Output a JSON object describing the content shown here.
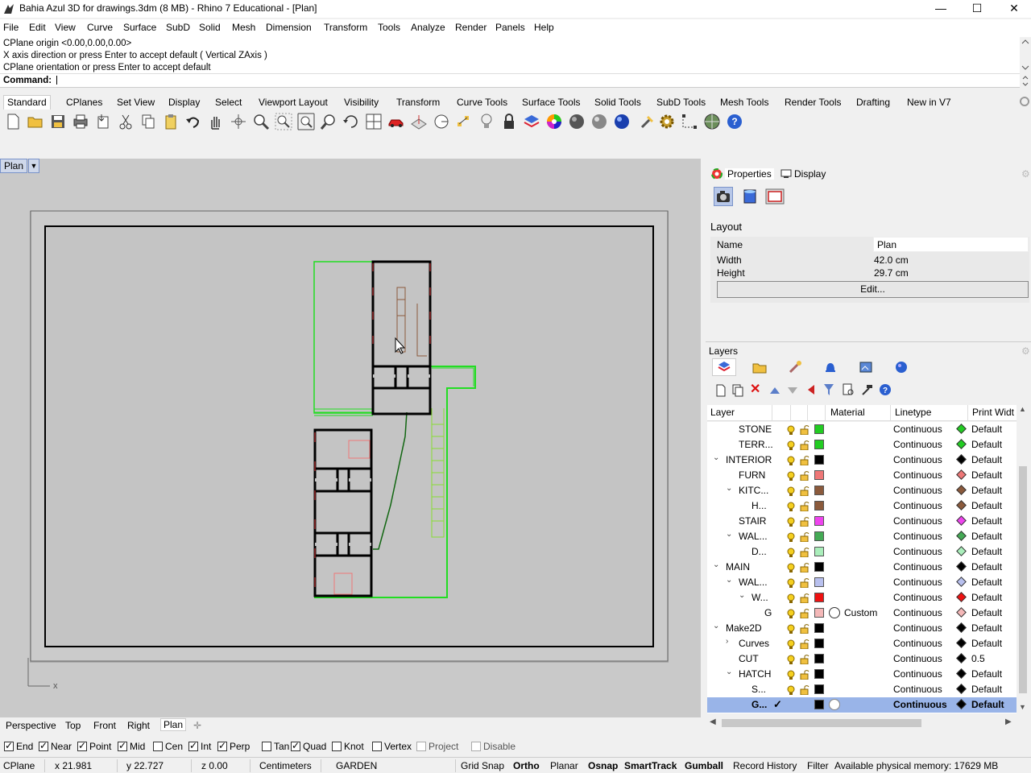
{
  "window": {
    "title": "Bahia Azul 3D for drawings.3dm (8 MB) - Rhino 7 Educational - [Plan]",
    "minimize": "—",
    "maximize": "☐",
    "close": "✕"
  },
  "menu": [
    "File",
    "Edit",
    "View",
    "Curve",
    "Surface",
    "SubD",
    "Solid",
    "Mesh",
    "Dimension",
    "Transform",
    "Tools",
    "Analyze",
    "Render",
    "Panels",
    "Help"
  ],
  "command": {
    "history": [
      "CPlane origin <0.00,0.00,0.00>",
      "X axis direction or press Enter to accept default ( Vertical  ZAxis )",
      "CPlane orientation or press Enter to accept default"
    ],
    "prompt": "Command:"
  },
  "toolbar_tabs": [
    "Standard",
    "CPlanes",
    "Set View",
    "Display",
    "Select",
    "Viewport Layout",
    "Visibility",
    "Transform",
    "Curve Tools",
    "Surface Tools",
    "Solid Tools",
    "SubD Tools",
    "Mesh Tools",
    "Render Tools",
    "Drafting",
    "New in V7"
  ],
  "toolbar_icons": [
    "new-icon",
    "open-icon",
    "save-icon",
    "print-icon",
    "import-icon",
    "cut-icon",
    "copy-icon",
    "paste-icon",
    "undo-icon",
    "pan-icon",
    "rotate-view-icon",
    "zoom-icon",
    "zoom-window-icon",
    "zoom-extents-icon",
    "zoom-selected-icon",
    "rotate-icon",
    "four-viewports-icon",
    "car-icon",
    "cplane-icon",
    "circle-icon",
    "points-icon",
    "light-icon",
    "lock-icon",
    "layers-icon",
    "color-wheel-icon",
    "sphere-gray-icon",
    "sphere-shaded-icon",
    "sphere-blue-icon",
    "brush-icon",
    "gear-icon",
    "dimension-icon",
    "globe-icon",
    "help-icon"
  ],
  "viewport": {
    "label": "Plan",
    "axis_label": "x"
  },
  "view_tabs": [
    "Perspective",
    "Top",
    "Front",
    "Right",
    "Plan"
  ],
  "properties_panel": {
    "tabs": [
      "Properties",
      "Display"
    ],
    "section": "Layout",
    "name_label": "Name",
    "name_value": "Plan",
    "width_label": "Width",
    "width_value": "42.0 cm",
    "height_label": "Height",
    "height_value": "29.7 cm",
    "edit_button": "Edit..."
  },
  "layers_panel": {
    "title": "Layers",
    "columns": [
      "Layer",
      "Material",
      "Linetype",
      "Print Widt"
    ],
    "rows": [
      {
        "name": "STONE",
        "indent": 39,
        "expander": "",
        "color": "#22cc22",
        "linetype": "Continuous",
        "diamond": "#22cc22",
        "pw": "Default",
        "material": ""
      },
      {
        "name": "TERR...",
        "indent": 39,
        "expander": "",
        "color": "#22cc22",
        "linetype": "Continuous",
        "diamond": "#22cc22",
        "pw": "Default",
        "material": ""
      },
      {
        "name": "INTERIOR",
        "indent": 23,
        "expander": "⌄",
        "color": "#000000",
        "linetype": "Continuous",
        "diamond": "#000000",
        "pw": "Default",
        "material": ""
      },
      {
        "name": "FURN",
        "indent": 39,
        "expander": "",
        "color": "#ee7777",
        "linetype": "Continuous",
        "diamond": "#ee7777",
        "pw": "Default",
        "material": ""
      },
      {
        "name": "KITC...",
        "indent": 39,
        "expander": "⌄",
        "color": "#8b5a3c",
        "linetype": "Continuous",
        "diamond": "#8b5a3c",
        "pw": "Default",
        "material": ""
      },
      {
        "name": "H...",
        "indent": 55,
        "expander": "",
        "color": "#8b5a3c",
        "linetype": "Continuous",
        "diamond": "#8b5a3c",
        "pw": "Default",
        "material": ""
      },
      {
        "name": "STAIR",
        "indent": 39,
        "expander": "",
        "color": "#ee44ee",
        "linetype": "Continuous",
        "diamond": "#ee44ee",
        "pw": "Default",
        "material": ""
      },
      {
        "name": "WAL...",
        "indent": 39,
        "expander": "⌄",
        "color": "#44aa55",
        "linetype": "Continuous",
        "diamond": "#44aa55",
        "pw": "Default",
        "material": ""
      },
      {
        "name": "D...",
        "indent": 55,
        "expander": "",
        "color": "#aaeebb",
        "linetype": "Continuous",
        "diamond": "#aaeebb",
        "pw": "Default",
        "material": ""
      },
      {
        "name": "MAIN",
        "indent": 23,
        "expander": "⌄",
        "color": "#000000",
        "linetype": "Continuous",
        "diamond": "#000000",
        "pw": "Default",
        "material": ""
      },
      {
        "name": "WAL...",
        "indent": 39,
        "expander": "⌄",
        "color": "#b8c0ee",
        "linetype": "Continuous",
        "diamond": "#b8c0ee",
        "pw": "Default",
        "material": ""
      },
      {
        "name": "W...",
        "indent": 55,
        "expander": "⌄",
        "color": "#ee1111",
        "linetype": "Continuous",
        "diamond": "#ee1111",
        "pw": "Default",
        "material": ""
      },
      {
        "name": "G",
        "indent": 71,
        "expander": "",
        "color": "#f4b8b8",
        "linetype": "Continuous",
        "diamond": "#f4b8b8",
        "pw": "Default",
        "material": "Custom"
      },
      {
        "name": "Make2D",
        "indent": 23,
        "expander": "⌄",
        "color": "#000000",
        "linetype": "Continuous",
        "diamond": "#000000",
        "pw": "Default",
        "material": ""
      },
      {
        "name": "Curves",
        "indent": 39,
        "expander": "›",
        "color": "#000000",
        "linetype": "Continuous",
        "diamond": "#000000",
        "pw": "Default",
        "material": ""
      },
      {
        "name": "CUT",
        "indent": 39,
        "expander": "",
        "color": "#000000",
        "linetype": "Continuous",
        "diamond": "#000000",
        "pw": "0.5",
        "material": ""
      },
      {
        "name": "HATCH",
        "indent": 39,
        "expander": "⌄",
        "color": "#000000",
        "linetype": "Continuous",
        "diamond": "#000000",
        "pw": "Default",
        "material": ""
      },
      {
        "name": "S...",
        "indent": 55,
        "expander": "",
        "color": "#000000",
        "linetype": "Continuous",
        "diamond": "#000000",
        "pw": "Default",
        "material": ""
      },
      {
        "name": "G...",
        "indent": 55,
        "expander": "",
        "color": "#000000",
        "linetype": "Continuous",
        "diamond": "#000000",
        "pw": "Default",
        "material": "",
        "selected": true
      }
    ]
  },
  "osnap": [
    {
      "label": "End",
      "on": true
    },
    {
      "label": "Near",
      "on": true
    },
    {
      "label": "Point",
      "on": true
    },
    {
      "label": "Mid",
      "on": true
    },
    {
      "label": "Cen",
      "on": false
    },
    {
      "label": "Int",
      "on": true
    },
    {
      "label": "Perp",
      "on": true
    },
    {
      "label": "Tan",
      "on": false
    },
    {
      "label": "Quad",
      "on": true
    },
    {
      "label": "Knot",
      "on": false
    },
    {
      "label": "Vertex",
      "on": false
    },
    {
      "label": "Project",
      "on": false,
      "disabled": true
    },
    {
      "label": "Disable",
      "on": false,
      "disabled": true
    }
  ],
  "status": {
    "cplane": "CPlane",
    "x": "x 21.981",
    "y": "y 22.727",
    "z": "z 0.00",
    "units": "Centimeters",
    "layer": "GARDEN",
    "grid_snap": "Grid Snap",
    "ortho": "Ortho",
    "planar": "Planar",
    "osnap": "Osnap",
    "smarttrack": "SmartTrack",
    "gumball": "Gumball",
    "record_history": "Record History",
    "filter": "Filter",
    "memory": "Available physical memory: 17629 MB"
  }
}
